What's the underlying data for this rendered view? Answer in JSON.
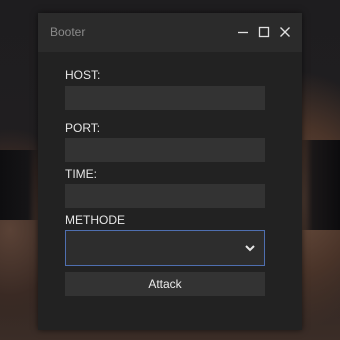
{
  "window": {
    "title": "Booter"
  },
  "form": {
    "host": {
      "label": "HOST:",
      "value": ""
    },
    "port": {
      "label": "PORT:",
      "value": ""
    },
    "time": {
      "label": "TIME:",
      "value": ""
    },
    "method": {
      "label": "METHODE",
      "selected": ""
    },
    "submit_label": "Attack"
  },
  "colors": {
    "window_bg": "#222222",
    "titlebar_bg": "#2b2b2b",
    "field_bg": "#333333",
    "focus_border": "#4f6fb0"
  }
}
